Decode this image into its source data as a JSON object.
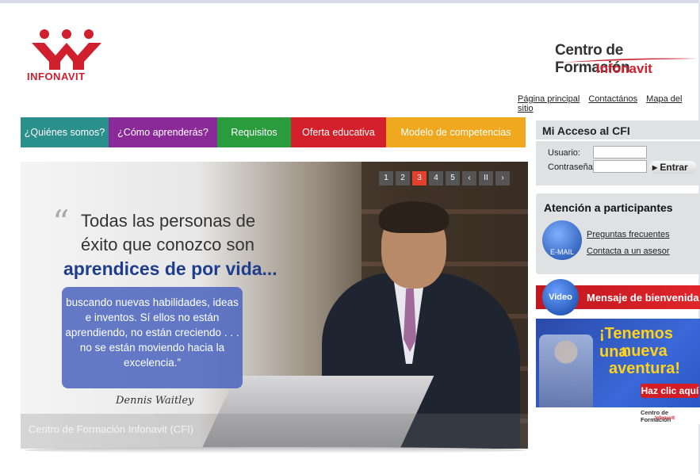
{
  "header": {
    "logo_text": "INFONAVIT",
    "site_title": "Centro de Formación",
    "site_subtitle": "Infonavit",
    "links": [
      "Página principal",
      "Contactános",
      "Mapa del sitio"
    ]
  },
  "nav": {
    "items": [
      "¿Quiénes somos?",
      "¿Cómo aprenderás?",
      "Requisitos",
      "Oferta educativa",
      "Modelo de competencias"
    ],
    "colors": [
      "#2b8f8c",
      "#8a2a98",
      "#2a9c3d",
      "#d4202a",
      "#f0a81e"
    ]
  },
  "hero": {
    "slider": [
      "1",
      "2",
      "3",
      "4",
      "5",
      "‹",
      "II",
      "›"
    ],
    "active_slide": 3,
    "quote_line1": "Todas las personas de",
    "quote_line2": "éxito que conozco son",
    "quote_line3": "aprendices de por vida...",
    "quote_body": "buscando nuevas habilidades, ideas e inventos. Sí ellos no están aprendiendo, no están creciendo . . . no se están moviendo hacia la excelencia.”",
    "author": "Dennis Waitley",
    "caption": "Centro de Formación Infonavit (CFI)"
  },
  "login": {
    "title": "Mi Acceso al CFI",
    "user_label": "Usuario:",
    "pass_label": "Contraseña:",
    "user_value": "",
    "pass_value": "",
    "enter_label": "▸ Entrar"
  },
  "attention": {
    "title": "Atención a participantes",
    "email_icon_label": "E-MAIL",
    "faq": "Preguntas frecuentes",
    "contact": "Contacta a un asesor"
  },
  "video": {
    "icon_label": "Video",
    "text": "Mensaje de bienvenida"
  },
  "promo": {
    "line1": "¡Tenemos una",
    "line2": "nueva",
    "line3": "aventura!",
    "button": "Haz clic aquí",
    "footer_title": "Centro de Formación",
    "footer_sub": "Infonavit"
  }
}
